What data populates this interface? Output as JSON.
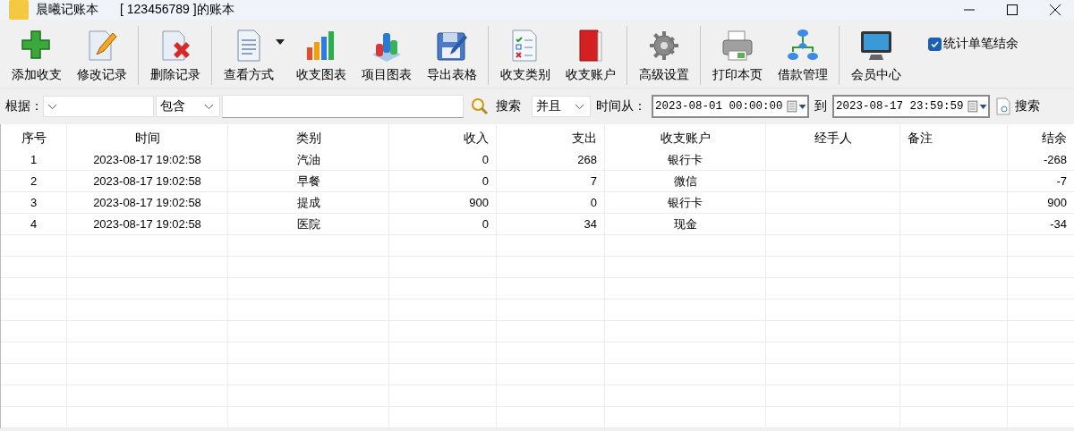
{
  "window": {
    "title": "晨曦记账本",
    "subtitle": "[ 123456789 ]的账本"
  },
  "toolbar": {
    "groups": [
      [
        {
          "label": "添加收支"
        },
        {
          "label": "修改记录"
        }
      ],
      [
        {
          "label": "删除记录"
        }
      ],
      [
        {
          "label": "查看方式",
          "dropdown": true
        },
        {
          "label": "收支图表"
        },
        {
          "label": "项目图表"
        },
        {
          "label": "导出表格"
        }
      ],
      [
        {
          "label": "收支类别"
        },
        {
          "label": "收支账户"
        }
      ],
      [
        {
          "label": "高级设置"
        }
      ],
      [
        {
          "label": "打印本页"
        },
        {
          "label": "借款管理"
        }
      ],
      [
        {
          "label": "会员中心"
        }
      ]
    ],
    "checkbox": {
      "label": "统计单笔结余",
      "checked": true
    }
  },
  "filter": {
    "by_label": "根据：",
    "operator": "包含",
    "search_button": "搜索",
    "logic": "并且",
    "time_from_label": "时间从：",
    "time_from": "2023-08-01 00:00:00",
    "time_to_label": "到",
    "time_to": "2023-08-17 23:59:59",
    "search_button_2": "搜索"
  },
  "table": {
    "columns": [
      "序号",
      "时间",
      "类别",
      "收入",
      "支出",
      "收支账户",
      "经手人",
      "备注",
      "结余"
    ],
    "rows": [
      [
        "1",
        "2023-08-17 19:02:58",
        "汽油",
        "0",
        "268",
        "银行卡",
        null,
        null,
        "-268"
      ],
      [
        "2",
        "2023-08-17 19:02:58",
        "早餐",
        "0",
        "7",
        "微信",
        null,
        null,
        "-7"
      ],
      [
        "3",
        "2023-08-17 19:02:58",
        "提成",
        "900",
        "0",
        "银行卡",
        null,
        null,
        "900"
      ],
      [
        "4",
        "2023-08-17 19:02:58",
        "医院",
        "0",
        "34",
        "现金",
        null,
        null,
        "-34"
      ]
    ]
  }
}
